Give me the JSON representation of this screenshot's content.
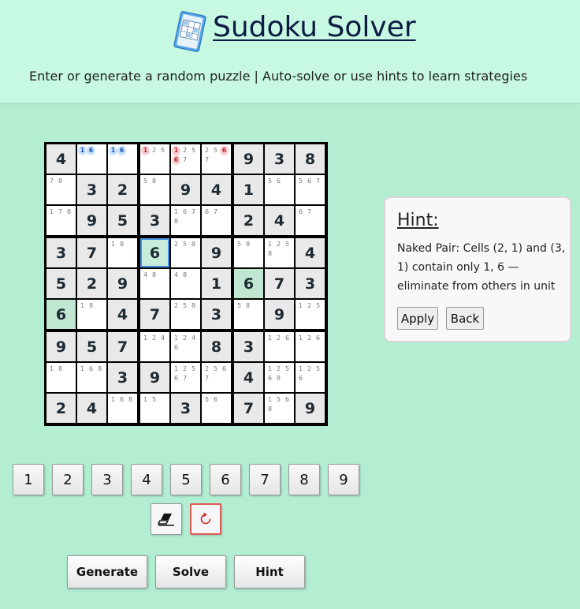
{
  "header": {
    "title": "Sudoku Solver",
    "subtitle": "Enter or generate a random puzzle | Auto-solve or use hints to learn strategies",
    "logo_icon": "sudoku-grid-icon"
  },
  "board": {
    "cells": [
      [
        {
          "v": "4",
          "g": true
        },
        {
          "n": [
            "1",
            "6"
          ],
          "c": "blue"
        },
        {
          "n": [
            "1",
            "6"
          ],
          "c": "blue"
        },
        {
          "n": [
            "1",
            "2",
            "5"
          ],
          "red": [
            "1"
          ]
        },
        {
          "n": [
            "1",
            "2",
            "5",
            "6",
            "7"
          ],
          "red": [
            "1",
            "6"
          ]
        },
        {
          "n": [
            "2",
            "5",
            "6",
            "7"
          ],
          "red": [
            "6"
          ]
        },
        {
          "v": "9",
          "g": true
        },
        {
          "v": "3",
          "g": true
        },
        {
          "v": "8",
          "g": true
        }
      ],
      [
        {
          "n": [
            "7",
            "8"
          ]
        },
        {
          "v": "3",
          "g": true
        },
        {
          "v": "2",
          "g": true
        },
        {
          "n": [
            "5",
            "8"
          ]
        },
        {
          "v": "9",
          "g": true
        },
        {
          "v": "4",
          "g": true
        },
        {
          "v": "1",
          "g": true
        },
        {
          "n": [
            "5",
            "6"
          ]
        },
        {
          "n": [
            "5",
            "6",
            "7"
          ]
        }
      ],
      [
        {
          "n": [
            "1",
            "7",
            "8"
          ]
        },
        {
          "v": "9",
          "g": true
        },
        {
          "v": "5",
          "g": true
        },
        {
          "v": "3",
          "g": true
        },
        {
          "n": [
            "1",
            "6",
            "7",
            "8"
          ]
        },
        {
          "n": [
            "6",
            "7"
          ]
        },
        {
          "v": "2",
          "g": true
        },
        {
          "v": "4",
          "g": true
        },
        {
          "n": [
            "6",
            "7"
          ]
        }
      ],
      [
        {
          "v": "3",
          "g": true
        },
        {
          "v": "7",
          "g": true
        },
        {
          "n": [
            "1",
            "8"
          ]
        },
        {
          "v": "6",
          "sel": true,
          "hl": true
        },
        {
          "n": [
            "2",
            "5",
            "8"
          ]
        },
        {
          "v": "9",
          "g": true
        },
        {
          "n": [
            "5",
            "8"
          ]
        },
        {
          "n": [
            "1",
            "2",
            "5",
            "8"
          ]
        },
        {
          "v": "4",
          "g": true
        }
      ],
      [
        {
          "v": "5",
          "g": true
        },
        {
          "v": "2",
          "g": true
        },
        {
          "v": "9",
          "g": true
        },
        {
          "n": [
            "4",
            "8"
          ]
        },
        {
          "n": [
            "4",
            "8"
          ]
        },
        {
          "v": "1",
          "g": true
        },
        {
          "v": "6",
          "g": true,
          "hl": true
        },
        {
          "v": "7",
          "g": true
        },
        {
          "v": "3",
          "g": true
        }
      ],
      [
        {
          "v": "6",
          "g": true,
          "hl": true
        },
        {
          "n": [
            "1",
            "8"
          ]
        },
        {
          "v": "4",
          "g": true
        },
        {
          "v": "7",
          "g": true
        },
        {
          "n": [
            "2",
            "5",
            "8"
          ]
        },
        {
          "v": "3",
          "g": true
        },
        {
          "n": [
            "5",
            "8"
          ]
        },
        {
          "v": "9",
          "g": true
        },
        {
          "n": [
            "1",
            "2",
            "5"
          ]
        }
      ],
      [
        {
          "v": "9",
          "g": true
        },
        {
          "v": "5",
          "g": true
        },
        {
          "v": "7",
          "g": true
        },
        {
          "n": [
            "1",
            "2",
            "4"
          ]
        },
        {
          "n": [
            "1",
            "2",
            "4",
            "6"
          ]
        },
        {
          "v": "8",
          "g": true
        },
        {
          "v": "3",
          "g": true
        },
        {
          "n": [
            "1",
            "2",
            "6"
          ]
        },
        {
          "n": [
            "1",
            "2",
            "6"
          ]
        }
      ],
      [
        {
          "n": [
            "1",
            "8"
          ]
        },
        {
          "n": [
            "1",
            "6",
            "8"
          ]
        },
        {
          "v": "3",
          "g": true
        },
        {
          "v": "9",
          "g": true
        },
        {
          "n": [
            "1",
            "2",
            "5",
            "6",
            "7"
          ]
        },
        {
          "n": [
            "2",
            "5",
            "6",
            "7"
          ]
        },
        {
          "v": "4",
          "g": true
        },
        {
          "n": [
            "1",
            "2",
            "5",
            "6",
            "8"
          ]
        },
        {
          "n": [
            "1",
            "2",
            "5",
            "6"
          ]
        }
      ],
      [
        {
          "v": "2",
          "g": true
        },
        {
          "v": "4",
          "g": true
        },
        {
          "n": [
            "1",
            "6",
            "8"
          ]
        },
        {
          "n": [
            "1",
            "5"
          ]
        },
        {
          "v": "3",
          "g": true
        },
        {
          "n": [
            "5",
            "6"
          ]
        },
        {
          "v": "7",
          "g": true
        },
        {
          "n": [
            "1",
            "5",
            "6",
            "8"
          ]
        },
        {
          "v": "9",
          "g": true
        }
      ]
    ]
  },
  "hint": {
    "title": "Hint:",
    "text": "Naked Pair: Cells (2, 1) and (3, 1) contain only 1, 6 — eliminate from others in unit",
    "apply_label": "Apply",
    "back_label": "Back"
  },
  "numpad": [
    "1",
    "2",
    "3",
    "4",
    "5",
    "6",
    "7",
    "8",
    "9"
  ],
  "tools": {
    "erase_icon": "eraser-icon",
    "reset_icon": "reset-icon",
    "reset_color": "#e05a56"
  },
  "actions": {
    "generate": "Generate",
    "solve": "Solve",
    "hint": "Hint"
  },
  "colors": {
    "background": "#b3eed3",
    "header": "#c6f8e2",
    "highlight": "#c7ecd9",
    "selected_border": "#4a90e2"
  }
}
